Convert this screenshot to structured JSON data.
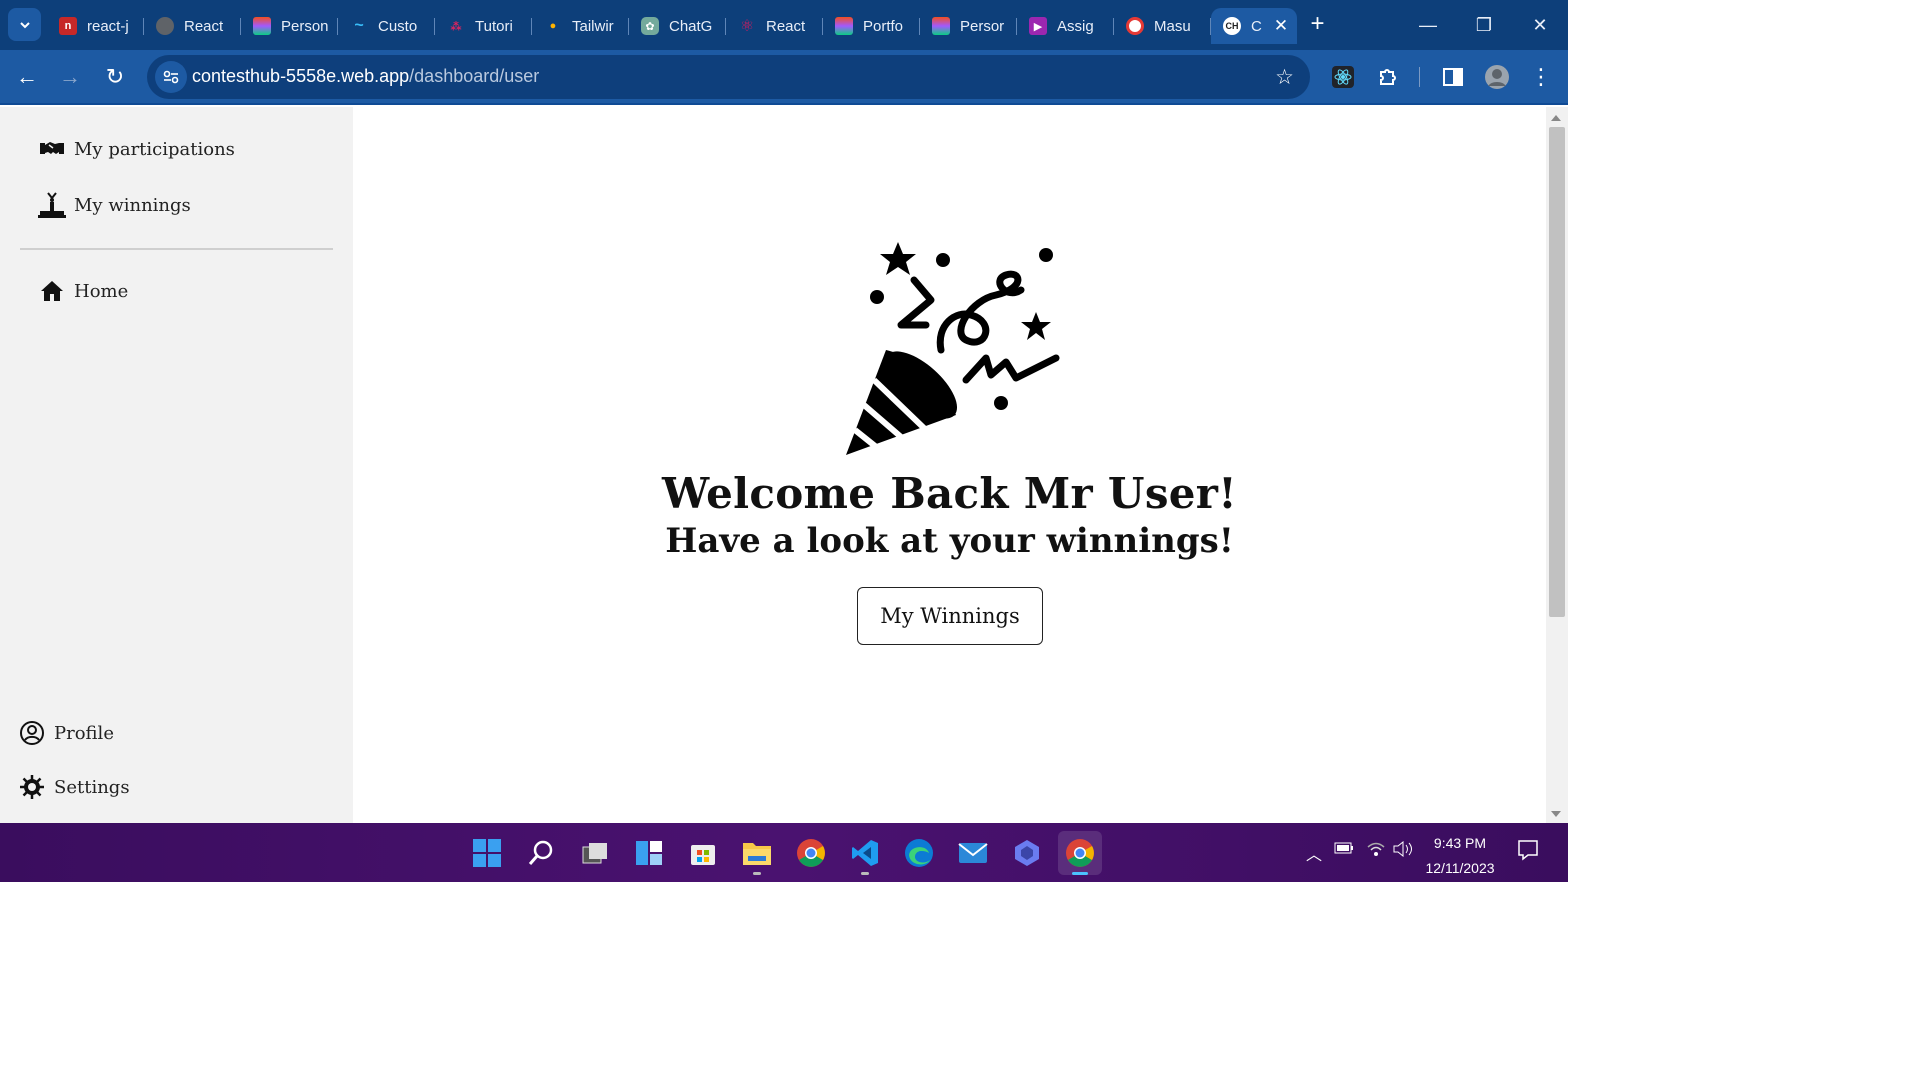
{
  "browser": {
    "tabs": [
      {
        "label": "react-j",
        "favicon_color": "#c62828"
      },
      {
        "label": "React",
        "favicon_color": "#5f6368"
      },
      {
        "label": "Person",
        "favicon_color": "#f24e1e"
      },
      {
        "label": "Custo",
        "favicon_color": "#38bdf8"
      },
      {
        "label": "Tutori",
        "favicon_color": "#e0245e"
      },
      {
        "label": "Tailwir",
        "favicon_color": "#ffb300"
      },
      {
        "label": "ChatG",
        "favicon_color": "#74aa9c"
      },
      {
        "label": "React",
        "favicon_color": "#d81b60"
      },
      {
        "label": "Portfo",
        "favicon_color": "#f24e1e"
      },
      {
        "label": "Persor",
        "favicon_color": "#f24e1e"
      },
      {
        "label": "Assig",
        "favicon_color": "#9c27b0"
      },
      {
        "label": "Masu",
        "favicon_color": "#e53935"
      },
      {
        "label": "C",
        "favicon_color": "#222222"
      }
    ],
    "url_host": "contesthub-5558e.web.app",
    "url_path": "/dashboard/user"
  },
  "sidebar": {
    "items": [
      {
        "label": "My participations",
        "icon": "handshake-icon"
      },
      {
        "label": "My winnings",
        "icon": "podium-icon"
      },
      {
        "label": "Home",
        "icon": "home-icon"
      }
    ],
    "bottom_items": [
      {
        "label": "Profile",
        "icon": "user-circle-icon"
      },
      {
        "label": "Settings",
        "icon": "gear-icon"
      }
    ]
  },
  "main": {
    "heading": "Welcome Back Mr User!",
    "subheading": "Have a look at your winnings!",
    "button_label": "My Winnings",
    "illustration": "party-popper-icon"
  },
  "taskbar": {
    "time": "9:43 PM",
    "date": "12/11/2023"
  },
  "colors": {
    "tabstrip": "#0d3f7a",
    "toolbar": "#1d5aa3",
    "sidebar": "#f2f2f2",
    "taskbar": "#4a1270"
  }
}
